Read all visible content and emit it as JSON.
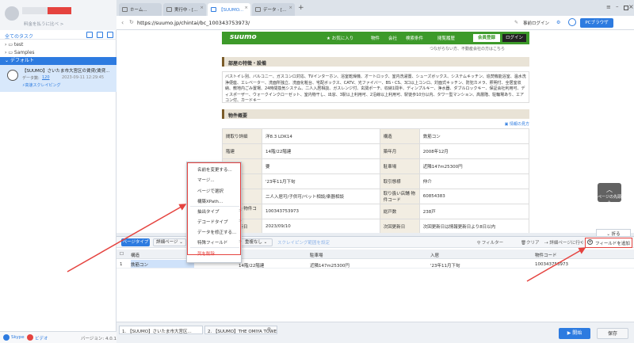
{
  "sidebar": {
    "subtitle": "料金を払うに比べ >",
    "all_tasks": "全てのタスク",
    "folders": [
      {
        "label": "test"
      },
      {
        "label": "Samples"
      }
    ],
    "default_folder": "デフォルト",
    "task": {
      "title": "【SUUMO】さいたま市大宮区の賃貸(賃貸...",
      "count_label": "データ数:",
      "count": "120",
      "time": "2023-09-11 12:29:45",
      "mode": "高速スクレイピング"
    },
    "footer": {
      "skype": "Skype",
      "video": "ビデオ",
      "version": "バージョン: 4.0.1"
    }
  },
  "tabs": [
    {
      "label": "ホーム..."
    },
    {
      "label": "実行中 - [..."
    },
    {
      "label": "【SUUMO..."
    },
    {
      "label": "データ - [..."
    }
  ],
  "browser": {
    "url": "https://suumo.jp/chintai/bc_100343753973/",
    "login": "事前ログイン",
    "pc_browser": "PCブラウザ"
  },
  "suumo": {
    "logo": "suumo",
    "favorites": "お気に入り",
    "nav1": "物件",
    "nav2": "会社",
    "nav3": "検索条件",
    "nav4": "閲覧履歴",
    "register": "会員登録",
    "login": "ログイン",
    "note": "つながらない方、不動産会社の方はこちら"
  },
  "features": {
    "title": "部屋の特徴・設備",
    "text": "バストイレ別、バルコニー、ガスコンロ対応、TVインターホン、浴室乾燥機、オートロック、室内洗濯置、シューズボックス、システムキッチン、追焚機能浴室、温水洗浄便座、エレベーター、洗面所独立、洗面化粧台、宅配ボックス、CATV、光ファイバー、BS・CS、3口以上コンロ、対面式キッチン、防犯カメラ、照明付、全居室収納、敷地内ごみ置場、24時間換気システム、二人入居相談、ガスレンジ付、玄関ポーチ、収納1間半、ディンプルキー、浄水器、ダブルロックキー、保証会社利用可、ディスポーザー、ウォークインクローゼット、室内物干し、出窓、3駅以上利用可、2沿線以上利用可、駅徒歩10分以内、タワー型マンション、高層階、駐輪場あり、エアコン付、カードキー"
  },
  "overview": {
    "title": "物件概要",
    "help": "情報の見方",
    "rows": [
      {
        "h1": "間取り詳細",
        "v1": "洋8.3 LDK14",
        "h2": "構造",
        "v2": "鉄筋コン"
      },
      {
        "h1": "階建",
        "v1": "14階/22階建",
        "h2": "築年月",
        "v2": "2008年12月"
      },
      {
        "h1": "損保",
        "v1": "要",
        "h2": "駐車場",
        "v2": "近隣147m25300円"
      },
      {
        "h1": "入居",
        "v1": "'23年11月下旬",
        "h2": "取引態様",
        "v2": "仲介"
      },
      {
        "h1": "条件",
        "v1": "二人入居可/子供可/ペット相談/楽器相談",
        "h2": "取り扱い店舗 物件コード",
        "v2": "60854383"
      },
      {
        "h1": "SUUMO 物件コード",
        "v1": "100343753973",
        "h2": "総戸数",
        "v2": "238戸"
      },
      {
        "h1": "情報更新日",
        "v1": "2023/09/10",
        "h2": "次回更新日",
        "v2": "次回更新日は情報更新日より8日以内"
      }
    ]
  },
  "context_menu": {
    "items": [
      {
        "label": "名前を変更する...",
        "arrow": ""
      },
      {
        "label": "マージ...",
        "arrow": ""
      },
      {
        "label": "ページで選択",
        "arrow": ""
      },
      {
        "label": "構築XPath...",
        "arrow": ""
      },
      {
        "label": "抽出タイプ",
        "arrow": ">"
      },
      {
        "label": "デコードタイプ",
        "arrow": ">"
      },
      {
        "label": "データを修正する...",
        "arrow": ""
      },
      {
        "label": "特殊フィールド",
        "arrow": ">"
      },
      {
        "label": "列を削除",
        "arrow": ""
      }
    ]
  },
  "side_widget": {
    "label": "ページの先頭へ"
  },
  "data_panel": {
    "page_type": "ページタイプ",
    "page_type_value": "詳細ページ",
    "dedup_label": "重複なし",
    "scrape_link": "スクレイピング範囲を設定",
    "filter": "フィルター",
    "clear": "クリア",
    "detail_link": "詳細ページに行く",
    "more": "...",
    "add_field": "フィールドを追加",
    "collapse": "折る",
    "columns": [
      "構造",
      "駐車場",
      "入居",
      "物件コード"
    ],
    "rows": [
      {
        "index": "1",
        "c0": "鉄筋コン",
        "c0b": "14階/22階建",
        "c1": "近隣147m25300円",
        "c2": "'23年11月下旬",
        "c3": "100343753973"
      }
    ]
  },
  "bottom": {
    "tab1": "1. 【SUUMO】さいたま市大宮区...",
    "tab2": "2. 【SUUMO】THE OMIYA TOWE...",
    "start": "開始",
    "save": "保存"
  }
}
